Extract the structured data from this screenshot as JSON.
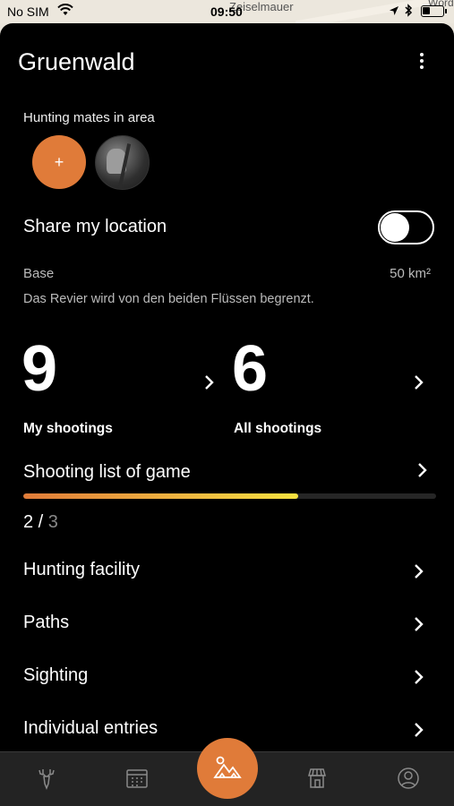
{
  "status": {
    "carrier": "No SIM",
    "time": "09:50",
    "map_label": "Zeiselmauer",
    "map_label2": "Wörd"
  },
  "header": {
    "title": "Gruenwald"
  },
  "mates": {
    "label": "Hunting mates in area",
    "add_label": "+"
  },
  "location": {
    "label": "Share my location",
    "enabled": false
  },
  "base": {
    "label": "Base",
    "value": "50 km²",
    "description": "Das Revier wird von den beiden Flüssen begrenzt."
  },
  "stats": {
    "my_count": "9",
    "my_label": "My shootings",
    "all_count": "6",
    "all_label": "All shootings"
  },
  "shooting_list": {
    "label": "Shooting list of game",
    "done": "2",
    "separator": " / ",
    "total": "3",
    "progress": 0.667
  },
  "menu": [
    {
      "label": "Hunting facility"
    },
    {
      "label": "Paths"
    },
    {
      "label": "Sighting"
    },
    {
      "label": "Individual entries"
    }
  ],
  "tabs": {
    "icons": [
      "deer-icon",
      "calendar-icon",
      "area-map-icon",
      "shop-icon",
      "profile-icon"
    ],
    "accent": "#e07b39"
  }
}
